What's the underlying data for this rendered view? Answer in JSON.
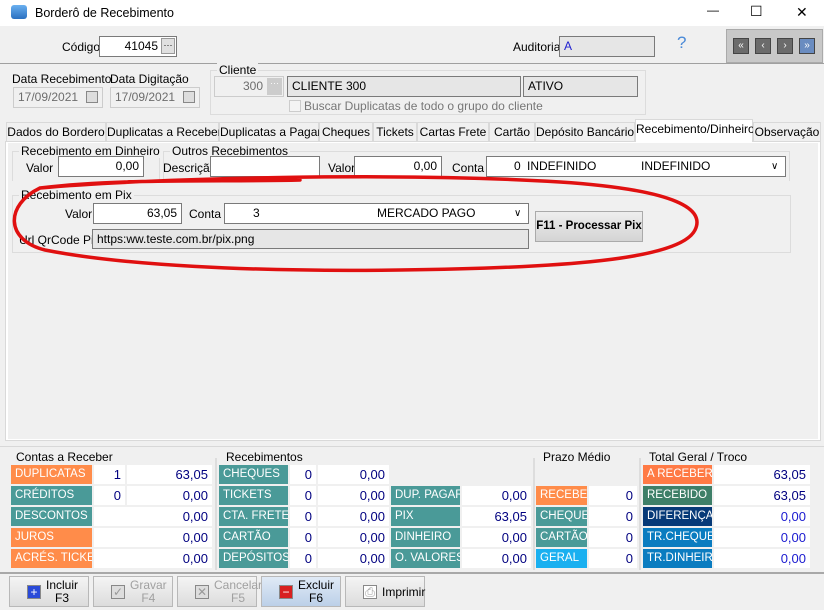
{
  "window": {
    "title": "Borderô de Recebimento",
    "minimize": "—",
    "maximize": "☐",
    "close": "✕"
  },
  "header": {
    "codigo_label": "Código",
    "codigo_value": "41045",
    "auditoria_label": "Auditoria",
    "auditoria_value": "A",
    "help": "?",
    "nav": [
      "«",
      "‹",
      "›",
      "»"
    ]
  },
  "dates": {
    "receb_label": "Data Recebimento",
    "receb_value": "17/09/2021",
    "dig_label": "Data Digitação",
    "dig_value": "17/09/2021"
  },
  "cliente": {
    "group": "Cliente",
    "code": "300",
    "name": "CLIENTE 300",
    "status": "ATIVO",
    "checkbox_label": "Buscar Duplicatas de todo o grupo do cliente",
    "checked": false
  },
  "tabs": [
    "Dados do Bordero",
    "Duplicatas a Receber",
    "Duplicatas a Pagar",
    "Cheques",
    "Tickets",
    "Cartas Frete",
    "Cartão",
    "Depósito Bancário",
    "Recebimento/Dinheiro",
    "Observação"
  ],
  "active_tab": "Recebimento/Dinheiro",
  "dinheiro": {
    "group": "Recebimento em Dinheiro",
    "valor_label": "Valor",
    "valor": "0,00"
  },
  "outros": {
    "group": "Outros Recebimentos",
    "descricao_label": "Descrição",
    "descricao": "",
    "valor_label": "Valor",
    "valor": "0,00",
    "conta_label": "Conta",
    "conta_code": "0",
    "conta_name": "INDEFINIDO",
    "conta_name2": "INDEFINIDO"
  },
  "pix": {
    "group": "Recebimento em Pix",
    "valor_label": "Valor",
    "valor": "63,05",
    "conta_label": "Conta",
    "conta_code": "3",
    "conta_name": "MERCADO PAGO",
    "url_label": "Url QrCode Pix",
    "url": "https:ww.teste.com.br/pix.png",
    "process_button": "F11 - Processar Pix"
  },
  "annotation_color": "#e01010",
  "summary": {
    "contas": {
      "title": "Contas a Receber",
      "rows": [
        {
          "label": "DUPLICATAS",
          "count": "1",
          "value": "63,05",
          "color": "#ff8c4a"
        },
        {
          "label": "CRÉDITOS",
          "count": "0",
          "value": "0,00",
          "color": "#4a9a98"
        },
        {
          "label": "DESCONTOS",
          "count": "",
          "value": "0,00",
          "color": "#4a9a98"
        },
        {
          "label": "JUROS",
          "count": "",
          "value": "0,00",
          "color": "#ff8c4a"
        },
        {
          "label": "ACRÉS. TICKET",
          "count": "",
          "value": "0,00",
          "color": "#ff8c4a"
        }
      ]
    },
    "receb": {
      "title": "Recebimentos",
      "rows": [
        {
          "label": "CHEQUES",
          "count": "0",
          "value": "0,00"
        },
        {
          "label": "TICKETS",
          "count": "0",
          "value": "0,00"
        },
        {
          "label": "CTA. FRETE",
          "count": "0",
          "value": "0,00"
        },
        {
          "label": "CARTÃO",
          "count": "0",
          "value": "0,00"
        },
        {
          "label": "DEPÓSITOS",
          "count": "0",
          "value": "0,00"
        }
      ],
      "extra": [
        {
          "label": "DUP. PAGAR",
          "value": "0,00"
        },
        {
          "label": "PIX",
          "value": "63,05"
        },
        {
          "label": "DINHEIRO",
          "value": "0,00"
        },
        {
          "label": "O. VALORES",
          "value": "0,00"
        }
      ]
    },
    "prazo": {
      "title": "Prazo Médio",
      "rows": [
        {
          "label": "RECEBER",
          "value": "0",
          "color": "#ff8c4a"
        },
        {
          "label": "CHEQUES",
          "value": "0",
          "color": "#4a9a98"
        },
        {
          "label": "CARTÃO",
          "value": "0",
          "color": "#4a9a98"
        },
        {
          "label": "GERAL",
          "value": "0",
          "color": "#1ab0f0"
        }
      ]
    },
    "total": {
      "title": "Total Geral / Troco",
      "rows": [
        {
          "label": "A RECEBER",
          "value": "63,05",
          "color": "#ff7a45"
        },
        {
          "label": "RECEBIDO",
          "value": "63,05",
          "color": "#3e7f68"
        },
        {
          "label": "DIFERENÇA",
          "value": "0,00",
          "color": "#073a78"
        },
        {
          "label": "TR.CHEQUE",
          "value": "0,00",
          "color": "#0a7cc0"
        },
        {
          "label": "TR.DINHEIRO",
          "value": "0,00",
          "color": "#0a7cc0"
        }
      ]
    }
  },
  "toolbar": [
    {
      "label": "Incluir",
      "key": "F3",
      "enabled": true
    },
    {
      "label": "Gravar",
      "key": "F4",
      "enabled": false
    },
    {
      "label": "Cancelar",
      "key": "F5",
      "enabled": false
    },
    {
      "label": "Excluir",
      "key": "F6",
      "enabled": true
    },
    {
      "label": "Imprimir",
      "key": "",
      "enabled": true
    }
  ]
}
